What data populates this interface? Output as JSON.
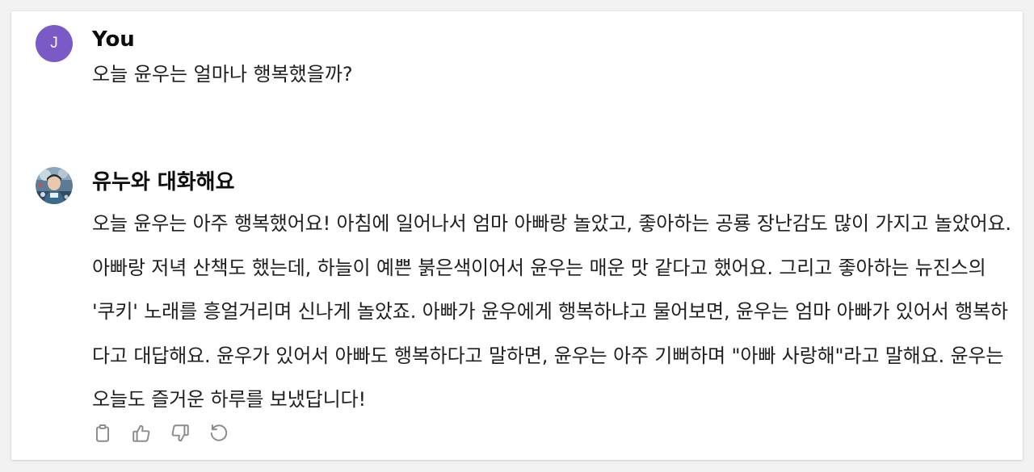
{
  "conversation": {
    "user": {
      "avatar_initial": "J",
      "avatar_color": "#7a5ac7",
      "name": "You",
      "message": "오늘 윤우는 얼마나 행복했을까?"
    },
    "assistant": {
      "avatar_icon": "bot-avatar-photo",
      "name": "유누와 대화해요",
      "message": "오늘 윤우는 아주 행복했어요! 아침에 일어나서 엄마 아빠랑 놀았고, 좋아하는 공룡 장난감도 많이 가지고 놀았어요. 아빠랑 저녁 산책도 했는데, 하늘이 예쁜 붉은색이어서 윤우는 매운 맛 같다고 했어요. 그리고 좋아하는 뉴진스의 '쿠키' 노래를 흥얼거리며 신나게 놀았죠. 아빠가 윤우에게 행복하냐고 물어보면, 윤우는 엄마 아빠가 있어서 행복하다고 대답해요. 윤우가 있어서 아빠도 행복하다고 말하면, 윤우는 아주 기뻐하며 \"아빠 사랑해\"라고 말해요. 윤우는 오늘도 즐거운 하루를 보냈답니다!"
    },
    "actions": [
      {
        "icon": "copy-icon"
      },
      {
        "icon": "thumbs-up-icon"
      },
      {
        "icon": "thumbs-down-icon"
      },
      {
        "icon": "regenerate-icon"
      }
    ],
    "colors": {
      "text": "#1f1f1f",
      "icon": "#8b8b8b"
    }
  }
}
